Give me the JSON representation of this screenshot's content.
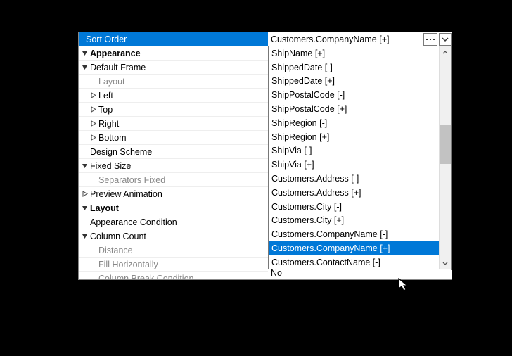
{
  "header": {
    "property": "Sort Order",
    "value": "Customers.CompanyName [+]"
  },
  "tree": [
    {
      "label": "Appearance",
      "depth": 1,
      "glyph": "down",
      "bold": true
    },
    {
      "label": "Default Frame",
      "depth": 1,
      "glyph": "down",
      "bold": false
    },
    {
      "label": "Layout",
      "depth": 2,
      "glyph": "none",
      "bold": false,
      "dim": true
    },
    {
      "label": "Left",
      "depth": 2,
      "glyph": "right",
      "bold": false
    },
    {
      "label": "Top",
      "depth": 2,
      "glyph": "right",
      "bold": false
    },
    {
      "label": "Right",
      "depth": 2,
      "glyph": "right",
      "bold": false
    },
    {
      "label": "Bottom",
      "depth": 2,
      "glyph": "right",
      "bold": false
    },
    {
      "label": "Design Scheme",
      "depth": 1,
      "glyph": "blank",
      "bold": false
    },
    {
      "label": "Fixed Size",
      "depth": 1,
      "glyph": "down",
      "bold": false
    },
    {
      "label": "Separators Fixed",
      "depth": 2,
      "glyph": "none",
      "bold": false,
      "dim": true
    },
    {
      "label": "Preview Animation",
      "depth": 1,
      "glyph": "right",
      "bold": false
    },
    {
      "label": "Layout",
      "depth": 1,
      "glyph": "down",
      "bold": true
    },
    {
      "label": "Appearance Condition",
      "depth": 1,
      "glyph": "blank",
      "bold": false
    },
    {
      "label": "Column Count",
      "depth": 1,
      "glyph": "down",
      "bold": false
    },
    {
      "label": "Distance",
      "depth": 2,
      "glyph": "none",
      "bold": false,
      "dim": true
    },
    {
      "label": "Fill Horizontally",
      "depth": 2,
      "glyph": "none",
      "bold": false,
      "dim": true
    },
    {
      "label": "Column Break Condition",
      "depth": 2,
      "glyph": "none",
      "bold": false,
      "dim": true
    }
  ],
  "dropdown": {
    "items": [
      {
        "text": "ShipName [+]",
        "selected": false
      },
      {
        "text": "ShippedDate [-]",
        "selected": false
      },
      {
        "text": "ShippedDate [+]",
        "selected": false
      },
      {
        "text": "ShipPostalCode [-]",
        "selected": false
      },
      {
        "text": "ShipPostalCode [+]",
        "selected": false
      },
      {
        "text": "ShipRegion [-]",
        "selected": false
      },
      {
        "text": "ShipRegion [+]",
        "selected": false
      },
      {
        "text": "ShipVia [-]",
        "selected": false
      },
      {
        "text": "ShipVia [+]",
        "selected": false
      },
      {
        "text": "Customers.Address [-]",
        "selected": false
      },
      {
        "text": "Customers.Address [+]",
        "selected": false
      },
      {
        "text": "Customers.City [-]",
        "selected": false
      },
      {
        "text": "Customers.City [+]",
        "selected": false
      },
      {
        "text": "Customers.CompanyName [-]",
        "selected": false
      },
      {
        "text": "Customers.CompanyName [+]",
        "selected": true
      },
      {
        "text": "Customers.ContactName [-]",
        "selected": false
      }
    ]
  },
  "bottom_value": "No"
}
